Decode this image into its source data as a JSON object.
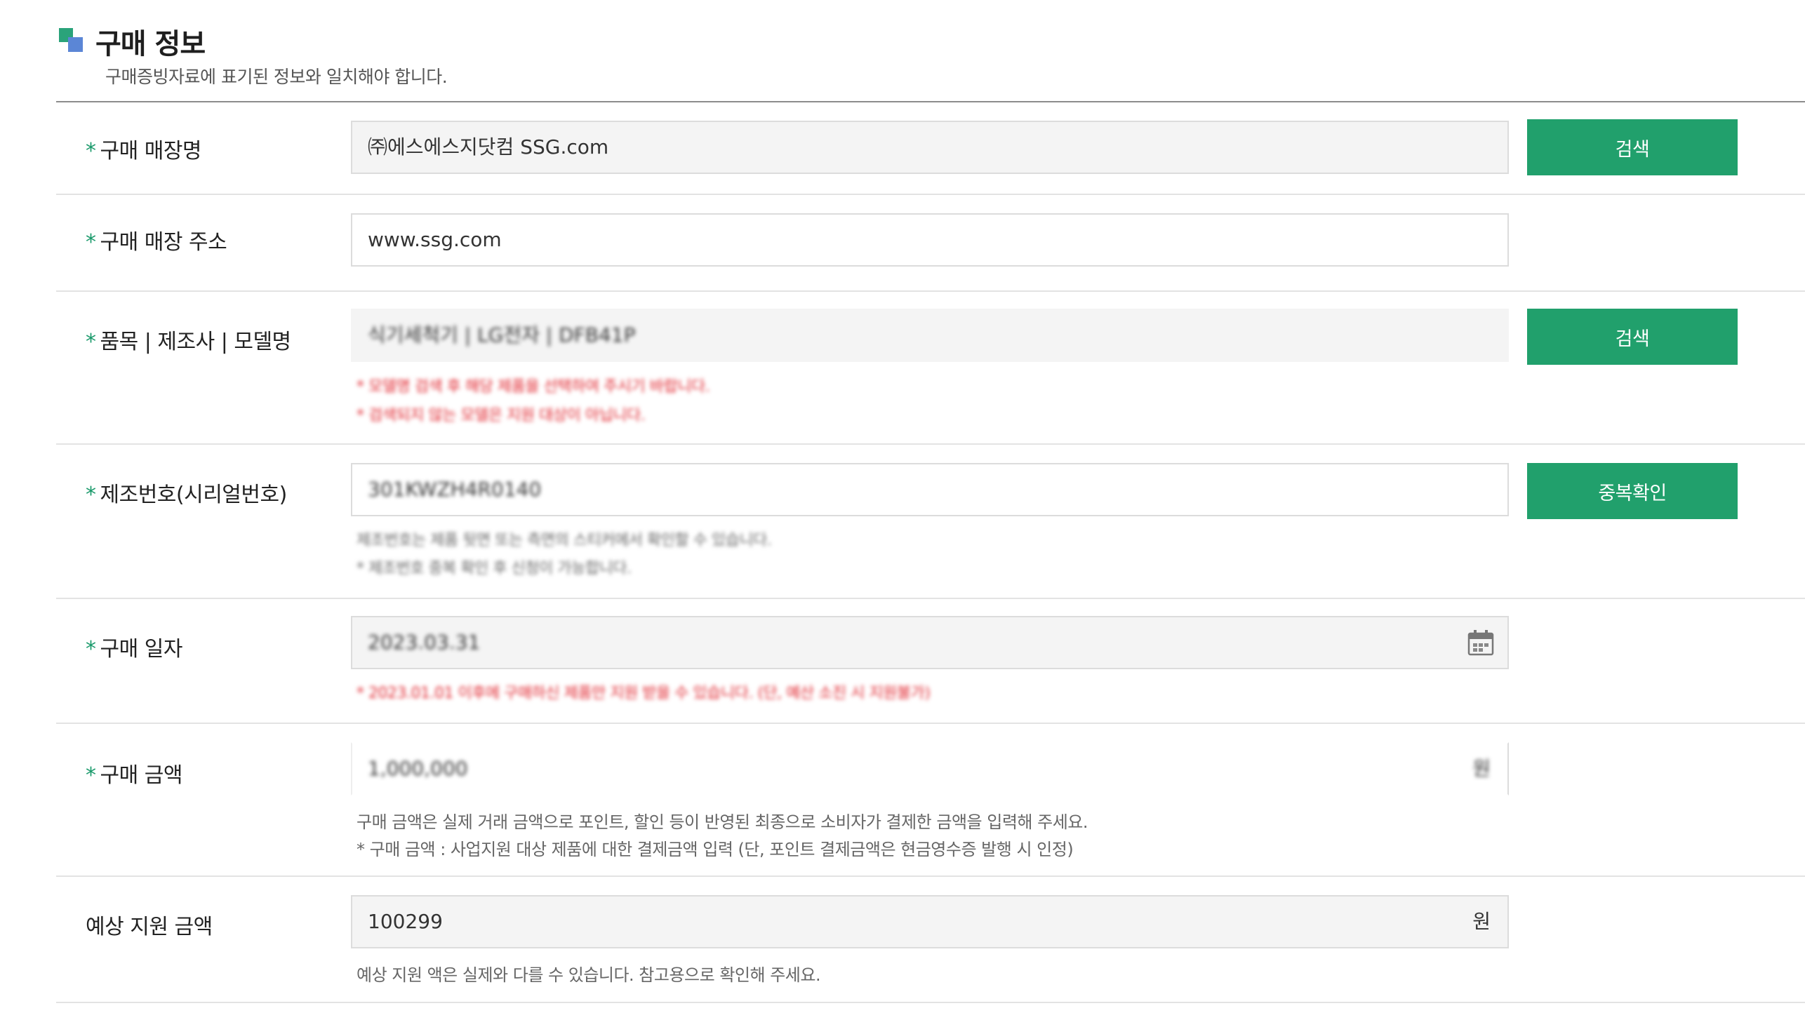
{
  "section": {
    "title": "구매 정보",
    "subtitle": "구매증빙자료에 표기된 정보와 일치해야 합니다."
  },
  "required_mark": "*",
  "store_name": {
    "label": "구매 매장명",
    "value": "㈜에스에스지닷컴 SSG.com",
    "button": "검색"
  },
  "store_address": {
    "label": "구매 매장 주소",
    "value": "www.ssg.com"
  },
  "product": {
    "label": "품목 | 제조사 | 모델명",
    "value": "식기세척기 | LG전자 | DFB41P",
    "button": "검색",
    "notes": [
      "* 모델명 검색 후 해당 제품을 선택하여 주시기 바랍니다.",
      "* 검색되지 않는 모델은 지원 대상이 아닙니다."
    ]
  },
  "serial": {
    "label": "제조번호(시리얼번호)",
    "value": "301KWZH4R0140",
    "button": "중복확인",
    "notes": [
      "제조번호는 제품 뒷면 또는 측면의 스티커에서 확인할 수 있습니다.",
      "* 제조번호 중복 확인 후 신청이 가능합니다."
    ]
  },
  "purchase_date": {
    "label": "구매 일자",
    "value": "2023.03.31",
    "note": "* 2023.01.01 이후에 구매하신 제품만 지원 받을 수 있습니다. (단, 예산 소진 시 지원불가)"
  },
  "purchase_amount": {
    "label": "구매 금액",
    "value": "1,000,000",
    "unit": "원",
    "notes": [
      "구매 금액은 실제 거래 금액으로 포인트, 할인 등이 반영된 최종으로 소비자가 결제한 금액을 입력해 주세요.",
      "* 구매 금액 : 사업지원 대상 제품에 대한 결제금액 입력 (단, 포인트 결제금액은 현금영수증 발행 시 인정)"
    ]
  },
  "expected_support": {
    "label": "예상 지원 금액",
    "value": "100299",
    "unit": "원",
    "note": "예상 지원 액은 실제와 다를 수 있습니다. 참고용으로 확인해 주세요."
  },
  "icons": {
    "section": "section-square-icon",
    "date": "calendar-icon"
  },
  "colors": {
    "accent_green": "#21a06c",
    "required_mark": "#1a9a6b",
    "error_red": "#e0242d"
  }
}
